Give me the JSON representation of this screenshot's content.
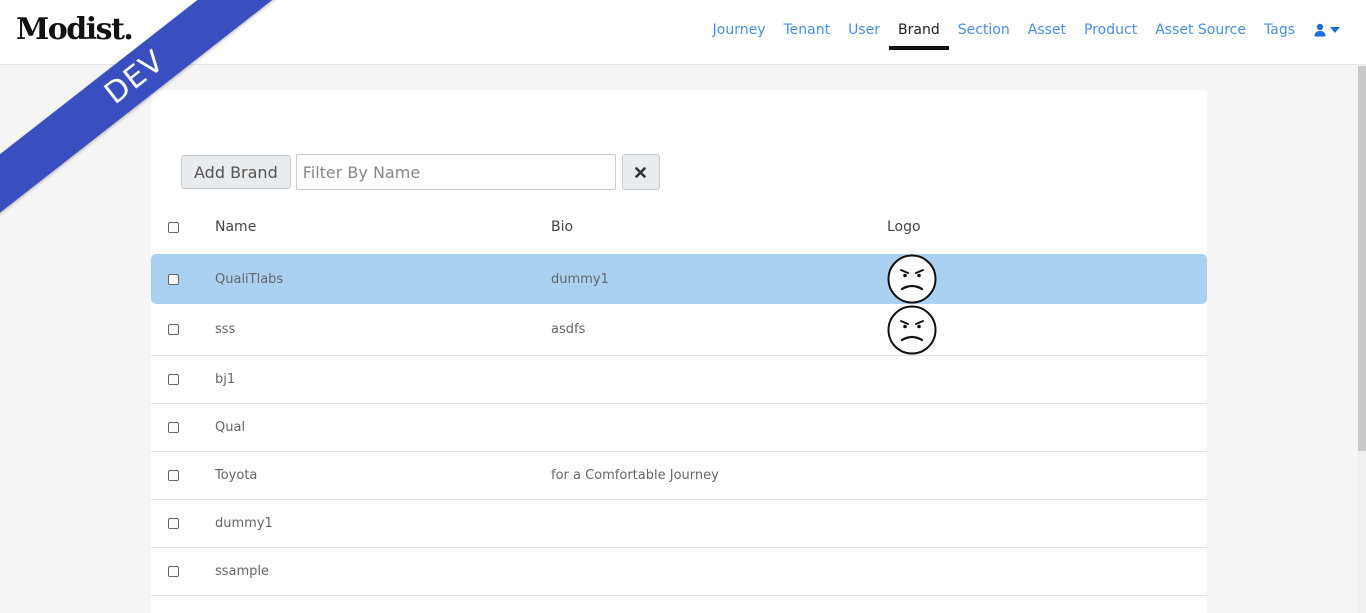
{
  "brand": {
    "logo_text": "Modist."
  },
  "env_badge": "DEV",
  "nav": {
    "items": [
      {
        "label": "Journey",
        "active": false
      },
      {
        "label": "Tenant",
        "active": false
      },
      {
        "label": "User",
        "active": false
      },
      {
        "label": "Brand",
        "active": true
      },
      {
        "label": "Section",
        "active": false
      },
      {
        "label": "Asset",
        "active": false
      },
      {
        "label": "Product",
        "active": false
      },
      {
        "label": "Asset Source",
        "active": false
      },
      {
        "label": "Tags",
        "active": false
      }
    ],
    "user_icon": "user-icon"
  },
  "toolbar": {
    "add_label": "Add Brand",
    "filter_placeholder": "Filter By Name",
    "filter_value": "",
    "clear_icon": "close-icon"
  },
  "table": {
    "columns": [
      "Name",
      "Bio",
      "Logo"
    ],
    "rows": [
      {
        "name": "QualiTlabs",
        "bio": "dummy1",
        "logo": "frown-face-icon",
        "selected": true
      },
      {
        "name": "sss",
        "bio": "asdfs",
        "logo": "frown-face-icon",
        "selected": false
      },
      {
        "name": "bj1",
        "bio": "",
        "logo": "",
        "selected": false
      },
      {
        "name": "Qual",
        "bio": "",
        "logo": "",
        "selected": false
      },
      {
        "name": "Toyota",
        "bio": "for a Comfortable Journey",
        "logo": "",
        "selected": false
      },
      {
        "name": "dummy1",
        "bio": "",
        "logo": "",
        "selected": false
      },
      {
        "name": "ssample",
        "bio": "",
        "logo": "",
        "selected": false
      }
    ]
  },
  "colors": {
    "accent": "#4a90e2",
    "ribbon": "#3a4fbf",
    "row_selected": "#aad1f2"
  }
}
